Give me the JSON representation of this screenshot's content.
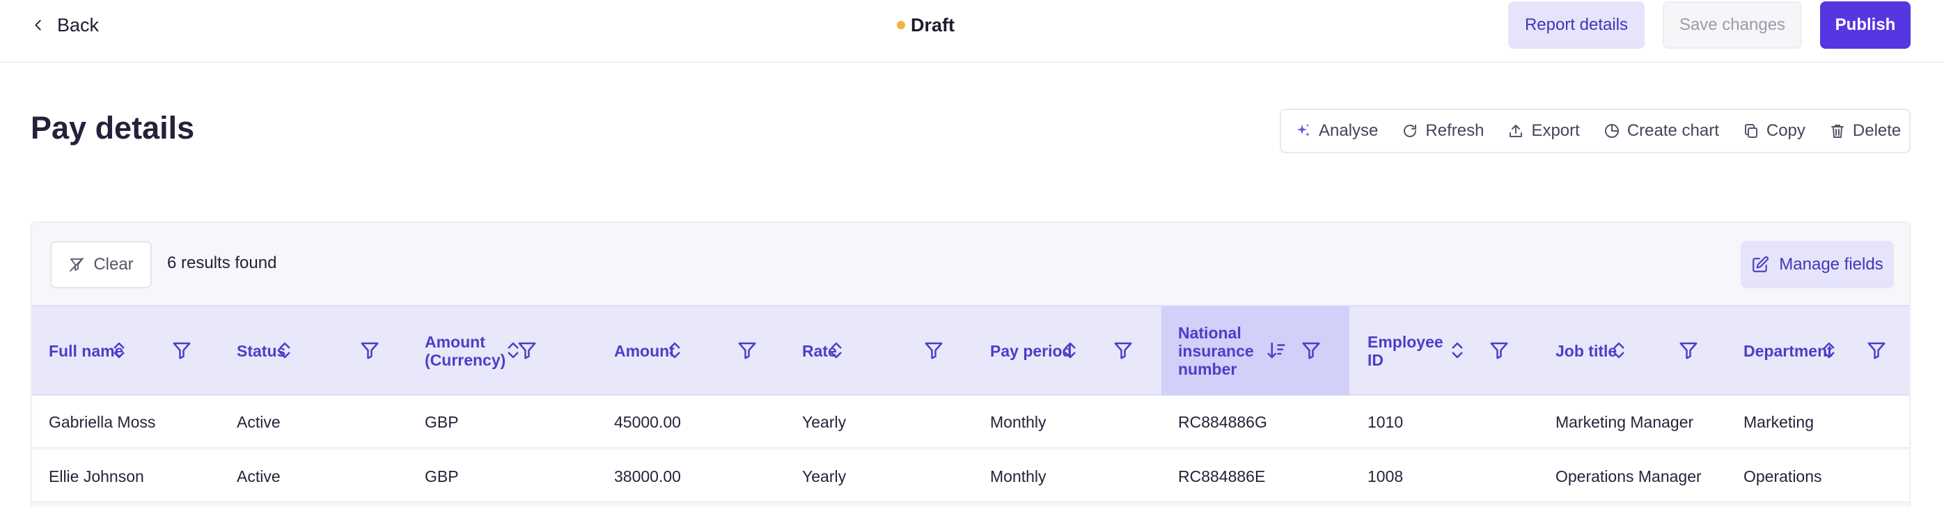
{
  "topbar": {
    "back_label": "Back",
    "status": "Draft",
    "status_color": "#f2b441",
    "report_details_label": "Report details",
    "save_changes_label": "Save changes",
    "publish_label": "Publish"
  },
  "page": {
    "title": "Pay details",
    "actions": [
      {
        "label": "Analyse",
        "icon": "sparkle-icon"
      },
      {
        "label": "Refresh",
        "icon": "refresh-icon"
      },
      {
        "label": "Export",
        "icon": "upload-icon"
      },
      {
        "label": "Create chart",
        "icon": "pie-chart-icon"
      },
      {
        "label": "Copy",
        "icon": "copy-icon"
      },
      {
        "label": "Delete",
        "icon": "trash-icon"
      }
    ]
  },
  "table": {
    "clear_label": "Clear",
    "results_text": "6 results found",
    "manage_fields_label": "Manage fields",
    "columns": [
      {
        "line1": "Full name",
        "line2": "",
        "line3": ""
      },
      {
        "line1": "Status",
        "line2": "",
        "line3": ""
      },
      {
        "line1": "Amount",
        "line2": "(Currency)",
        "line3": ""
      },
      {
        "line1": "Amount",
        "line2": "",
        "line3": ""
      },
      {
        "line1": "Rate",
        "line2": "",
        "line3": ""
      },
      {
        "line1": "Pay period",
        "line2": "",
        "line3": ""
      },
      {
        "line1": "National",
        "line2": "insurance",
        "line3": "number"
      },
      {
        "line1": "Employee",
        "line2": "ID",
        "line3": ""
      },
      {
        "line1": "Job title",
        "line2": "",
        "line3": ""
      },
      {
        "line1": "Department",
        "line2": "",
        "line3": ""
      }
    ],
    "sorted_column": "National insurance number",
    "rows": [
      [
        "Gabriella Moss",
        "Active",
        "GBP",
        "45000.00",
        "Yearly",
        "Monthly",
        "RC884886G",
        "1010",
        "Marketing Manager",
        "Marketing"
      ],
      [
        "Ellie Johnson",
        "Active",
        "GBP",
        "38000.00",
        "Yearly",
        "Monthly",
        "RC884886E",
        "1008",
        "Operations Manager",
        "Operations"
      ]
    ]
  },
  "colors": {
    "accent": "#5536e0",
    "header_text": "#4a3fc8",
    "header_bg": "#e9e8fb",
    "sorted_header_bg": "#d2cff8"
  }
}
